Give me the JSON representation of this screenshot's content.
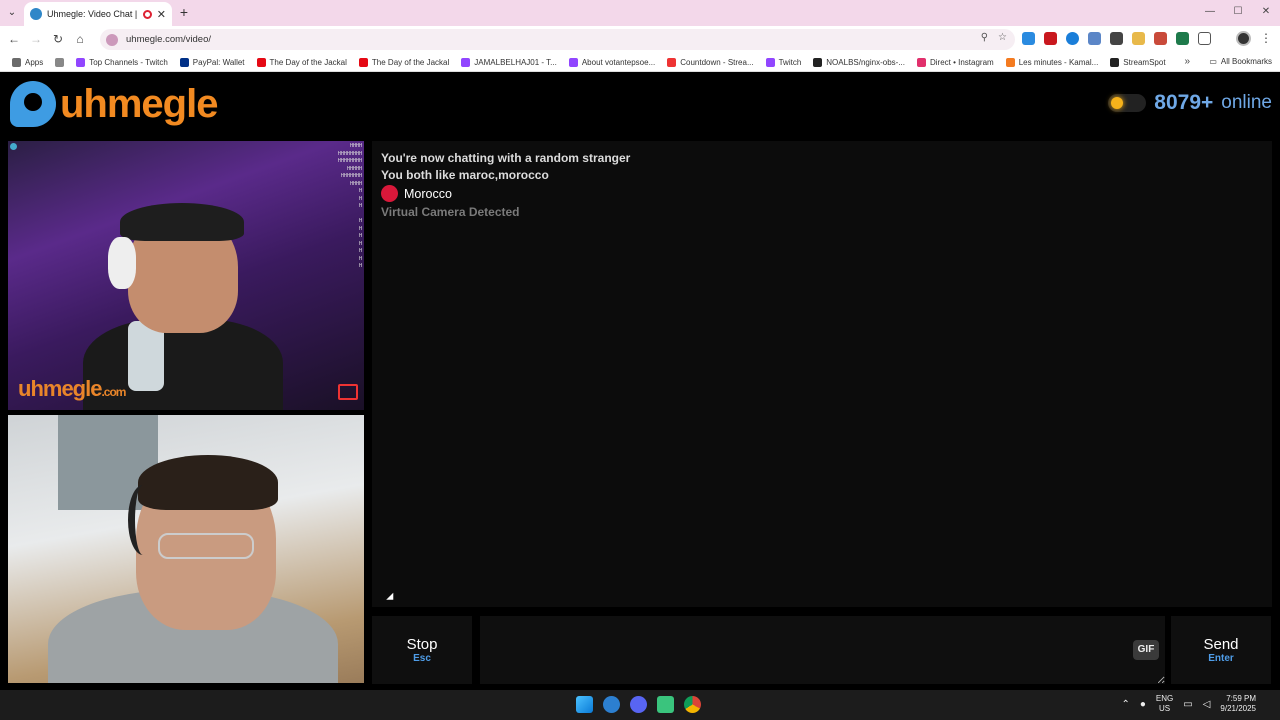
{
  "browser": {
    "tab_title": "Uhmegle: Video Chat | Om",
    "tab_close": "✕",
    "new_tab": "+",
    "url": "uhmegle.com/video/",
    "window_controls": [
      "—",
      "☐",
      "✕"
    ]
  },
  "bookmarks": {
    "items": [
      {
        "label": "Apps",
        "color": "#6b6b6b"
      },
      {
        "label": "Top Channels - Twitch",
        "color": "#9146ff"
      },
      {
        "label": "PayPal: Wallet",
        "color": "#003087"
      },
      {
        "label": "The Day of the Jackal",
        "color": "#e50914"
      },
      {
        "label": "The Day of the Jackal",
        "color": "#e50914"
      },
      {
        "label": "JAMALBELHAJ01 - T...",
        "color": "#9146ff"
      },
      {
        "label": "About votantepsoe...",
        "color": "#9146ff"
      },
      {
        "label": "Countdown - Strea...",
        "color": "#e33"
      },
      {
        "label": "Twitch",
        "color": "#9146ff"
      },
      {
        "label": "NOALBS/nginx-obs-...",
        "color": "#222"
      },
      {
        "label": "Direct • Instagram",
        "color": "#e1306c"
      },
      {
        "label": "Les minutes - Kamal...",
        "color": "#f47b20"
      },
      {
        "label": "StreamSpot",
        "color": "#222"
      }
    ],
    "all_label": "All Bookmarks"
  },
  "site": {
    "logo_text": "uhmegle",
    "online_count": "8079+",
    "online_label": "online"
  },
  "video": {
    "watermark": "uhmegle",
    "watermark_suffix": ".com"
  },
  "chat": {
    "line1": "You're now chatting with a random stranger",
    "line2": "You both like maroc,morocco",
    "country": "Morocco",
    "notice": "Virtual Camera Detected"
  },
  "controls": {
    "stop_label": "Stop",
    "stop_hint": "Esc",
    "gif_label": "GIF",
    "send_label": "Send",
    "send_hint": "Enter",
    "message_value": ""
  },
  "taskbar": {
    "lang_top": "ENG",
    "lang_bottom": "US",
    "time": "7:59 PM",
    "date": "9/21/2025"
  }
}
